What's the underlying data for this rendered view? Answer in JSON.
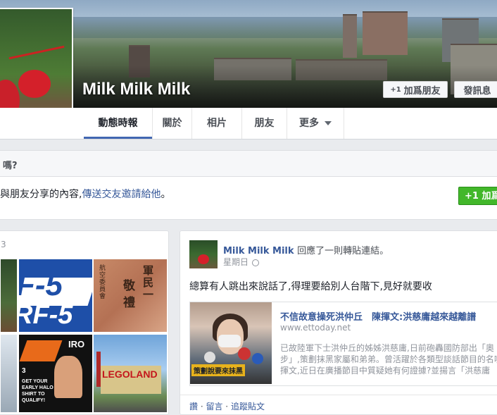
{
  "profile": {
    "name": "Milk Milk Milk",
    "add_friend_label": "加爲朋友",
    "message_label": "發訊息",
    "add_friend_icon": "+1"
  },
  "nav": {
    "tabs": [
      "動態時報",
      "關於",
      "相片",
      "朋友",
      "更多"
    ],
    "active_tab": "動態時報"
  },
  "prompt_panel": {
    "question_fragment": "嗎?"
  },
  "share_panel": {
    "text_fragment": "與朋友分享的內容,",
    "link_text": "傳送交友邀請給他",
    "text_suffix": "。",
    "button_icon": "+1",
    "button_label": "加爲"
  },
  "photos": {
    "header_fragment": "3",
    "tile_texts": [
      "F-5",
      "RF-5",
      "軍民一",
      "敬禮",
      "航空委員會",
      "IRO",
      "GET YOUR EARLY HALO SHIRT TO QUALIFY!",
      "LEGOLAND",
      "3"
    ]
  },
  "post": {
    "author": "Milk Milk Milk",
    "action": "回應了一則轉貼連結。",
    "time": "星期日",
    "body": "總算有人跳出來說話了,得理要給別人台階下,見好就要收",
    "link": {
      "title": "不信故意操死洪仲丘　陳揮文:洪慈庸越來越離譜",
      "domain": "www.ettoday.net",
      "description": "已故陸軍下士洪仲丘的姊姊洪慈庸,日前砲轟國防部出「奧步」,策劃抹黑家屬和弟弟。曾活躍於各類型談話節目的名嘴陳揮文,近日在廣播節目中質疑她有何證據?並揚言「洪慈庸",
      "thumb_caption": "策劃說要來抹黑"
    },
    "actions": [
      "讚",
      "留言",
      "追蹤貼文"
    ],
    "actions_sep": " · "
  }
}
